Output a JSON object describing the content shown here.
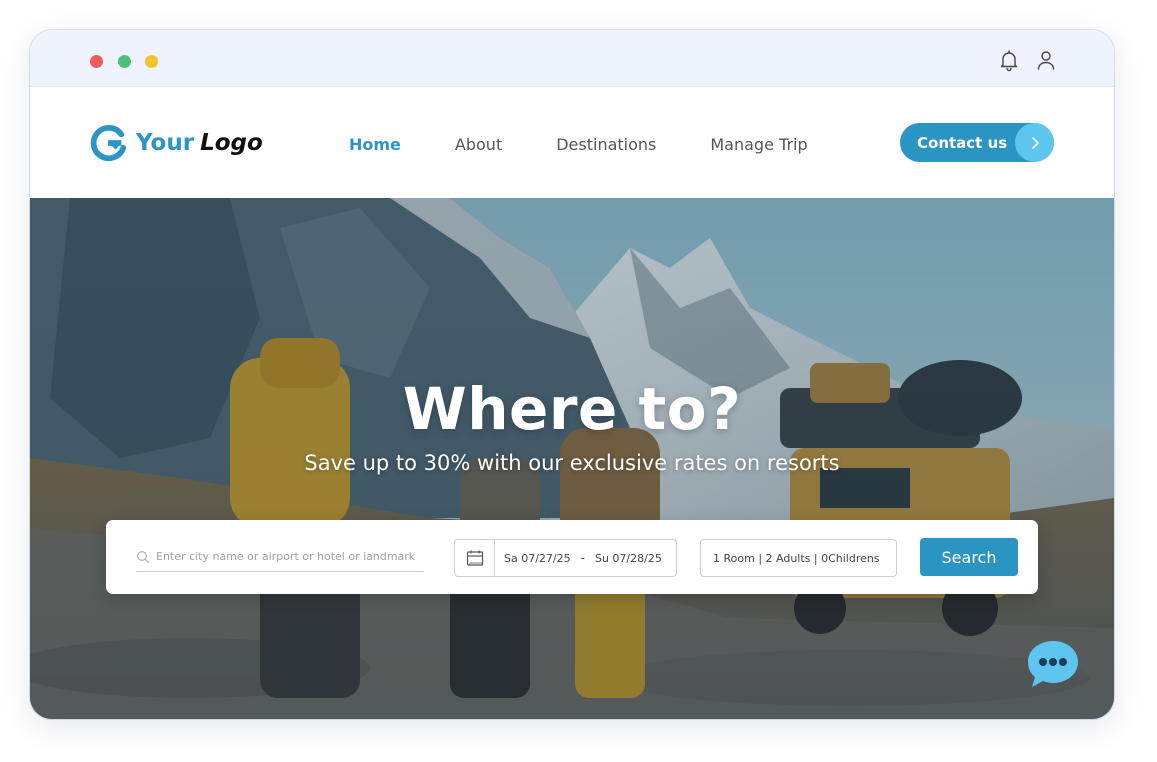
{
  "titlebar": {
    "icons": [
      "bell-icon",
      "user-icon"
    ],
    "traffic_lights": [
      "#ee5c5c",
      "#4cc17a",
      "#f2c230"
    ]
  },
  "logo": {
    "word1": "Your",
    "word2": "Logo",
    "mark_color": "#2d95c6"
  },
  "nav": {
    "links": [
      {
        "label": "Home",
        "active": true
      },
      {
        "label": "About",
        "active": false
      },
      {
        "label": "Destinations",
        "active": false
      },
      {
        "label": "Manage Trip",
        "active": false
      }
    ],
    "contact_label": "Contact us",
    "accent": "#2a94c3"
  },
  "hero": {
    "title": "Where to?",
    "subtitle": "Save up to 30% with our exclusive rates on resorts"
  },
  "search": {
    "destination_placeholder": "Enter city name or airport or hotel or landmark",
    "check_in": "Sa 07/27/25",
    "separator": "-",
    "check_out": "Su 07/28/25",
    "guests": "1  Room | 2 Adults | 0Childrens",
    "button_label": "Search"
  }
}
